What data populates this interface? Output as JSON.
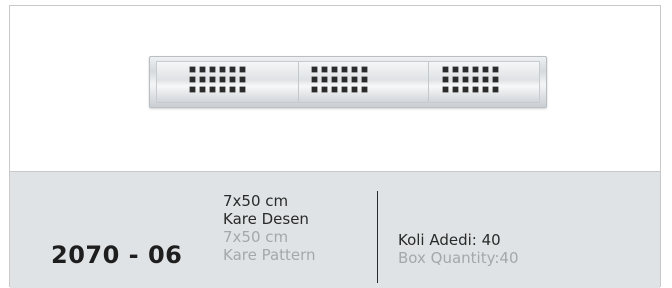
{
  "product": {
    "code": "2070 - 06",
    "size_tr": "7x50 cm",
    "name_tr": "Kare Desen",
    "size_en": "7x50 cm",
    "name_en": "Kare Pattern",
    "box_qty_tr": "Koli Adedi: 40",
    "box_qty_en": "Box Quantity:40"
  },
  "image": {
    "subject": "stainless steel linear shower drain grate with square pattern",
    "pattern_groups": 3,
    "rows_per_group": 3,
    "squares_per_row": 6
  },
  "colors": {
    "info_bar": "#dfe3e5",
    "primary_text": "#2a2a2a",
    "muted_text": "#a4a8aa"
  }
}
